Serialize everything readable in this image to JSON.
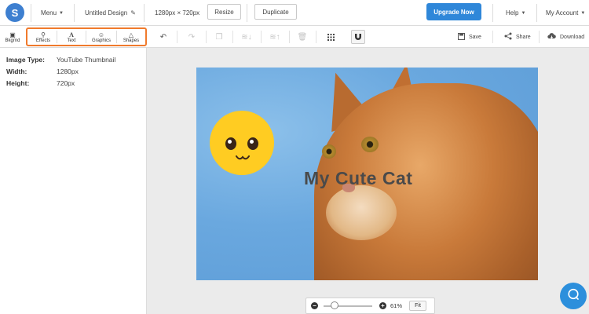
{
  "app": {
    "logo_letter": "S",
    "menu_label": "Menu",
    "design_title": "Untitled Design",
    "dimensions": "1280px × 720px",
    "resize_label": "Resize",
    "duplicate_label": "Duplicate",
    "upgrade_label": "Upgrade Now",
    "help_label": "Help",
    "account_label": "My Account",
    "accent_color": "#2f87d9"
  },
  "toolbar": {
    "background_label": "Bkgrnd",
    "effects_label": "Effects",
    "text_label": "Text",
    "graphics_label": "Graphics",
    "shapes_label": "Shapes",
    "save_label": "Save",
    "share_label": "Share",
    "download_label": "Download",
    "highlight_color": "#f07a2c"
  },
  "info": [
    {
      "label": "Image Type:",
      "value": "YouTube Thumbnail"
    },
    {
      "label": "Width:",
      "value": "1280px"
    },
    {
      "label": "Height:",
      "value": "720px"
    }
  ],
  "canvas": {
    "caption": "My Cute Cat"
  },
  "zoom": {
    "level_fraction": 0.15,
    "percent_label": "61%",
    "fit_label": "Fit"
  }
}
